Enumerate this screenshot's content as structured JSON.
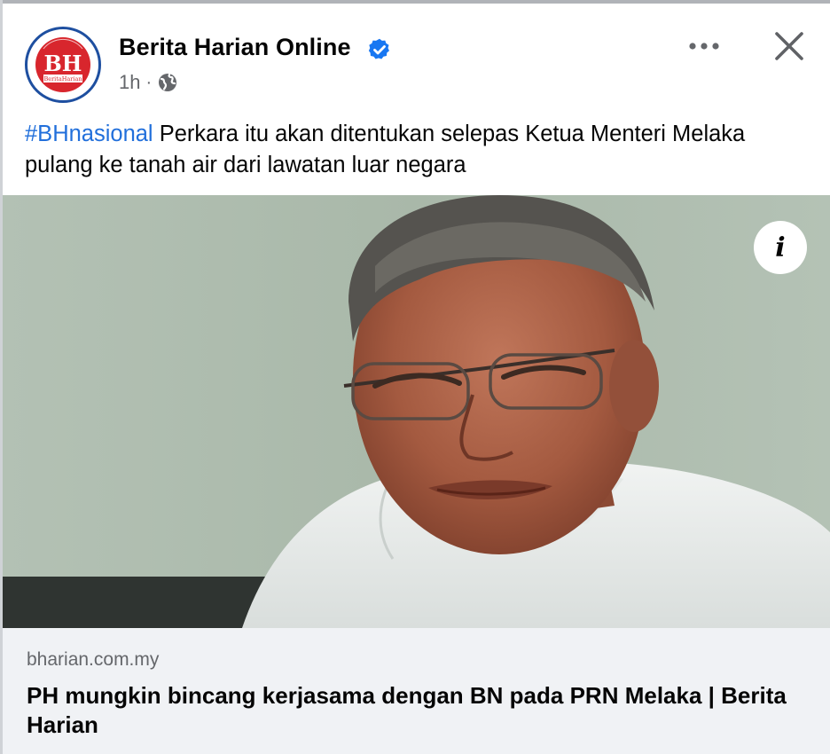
{
  "post": {
    "page_name": "Berita Harian Online",
    "time": "1h",
    "separator": "·",
    "avatar": {
      "logo_text": "BH",
      "sub_text": "BeritaHarian",
      "colors": {
        "red": "#d8262d",
        "blue": "#1e4fa0"
      }
    },
    "caption": {
      "hashtag": "#BHnasional",
      "text": " Perkara itu akan ditentukan selepas Ketua Menteri Melaka pulang ke tanah air dari lawatan luar negara"
    },
    "photo": {
      "info_label": "i"
    },
    "link": {
      "domain": "bharian.com.my",
      "headline": "PH mungkin bincang kerjasama dengan BN pada PRN Melaka | Berita Harian"
    }
  },
  "icons": {
    "verified": "verified-badge-icon",
    "privacy": "globe-icon",
    "more": "more-options-icon",
    "close": "close-icon",
    "info": "info-icon"
  },
  "colors": {
    "hashtag": "#216fdb",
    "verified": "#1877f2",
    "secondary_text": "#65676b",
    "link_card_bg": "#f0f2f5"
  }
}
